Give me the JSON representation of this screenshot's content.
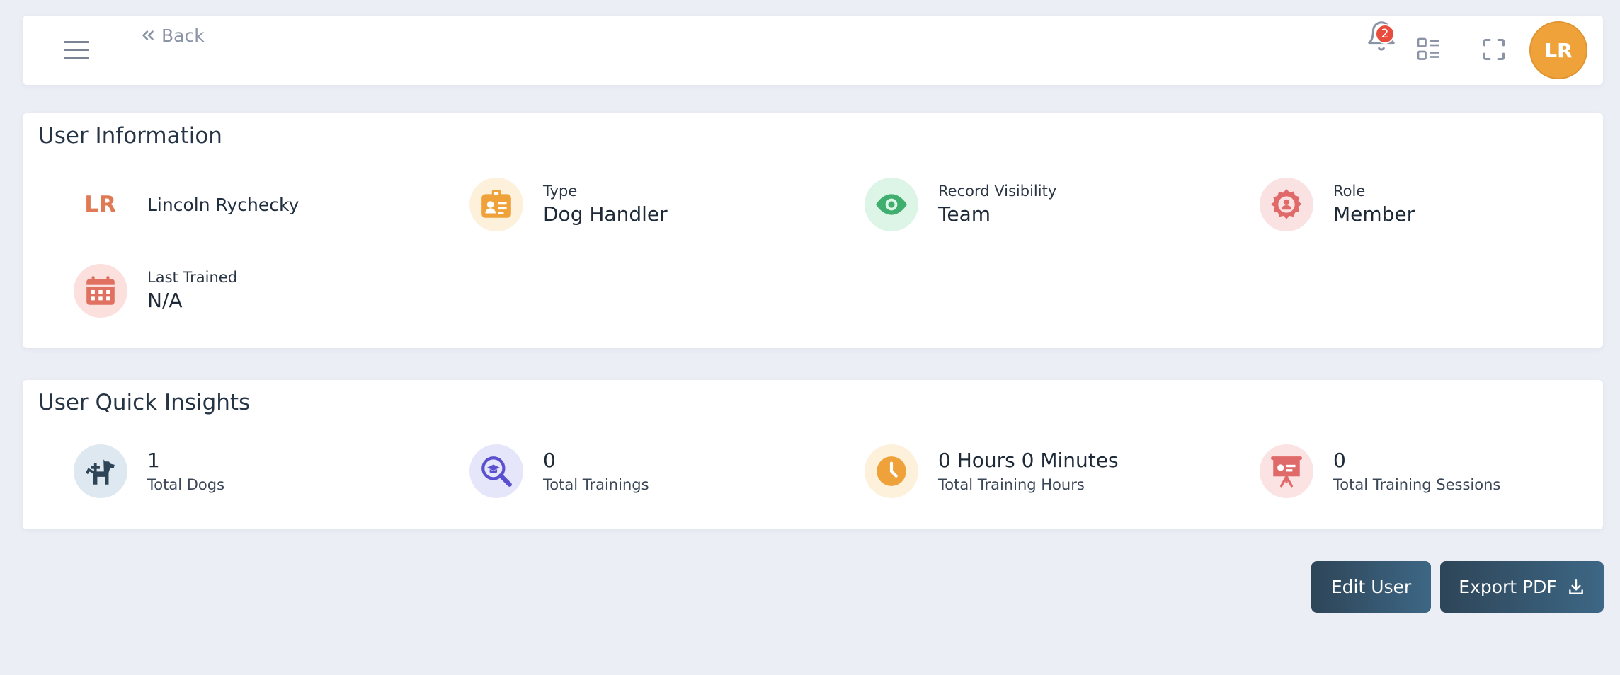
{
  "header": {
    "back_label": "Back",
    "notification_count": "2",
    "avatar_initials": "LR"
  },
  "user_info": {
    "title": "User Information",
    "initials": "LR",
    "name": "Lincoln Rychecky",
    "type_label": "Type",
    "type_value": "Dog Handler",
    "visibility_label": "Record Visibility",
    "visibility_value": "Team",
    "role_label": "Role",
    "role_value": "Member",
    "last_trained_label": "Last Trained",
    "last_trained_value": "N/A"
  },
  "insights": {
    "title": "User Quick Insights",
    "dogs_value": "1",
    "dogs_label": "Total Dogs",
    "trainings_value": "0",
    "trainings_label": "Total Trainings",
    "hours_value": "0 Hours 0 Minutes",
    "hours_label": "Total Training Hours",
    "sessions_value": "0",
    "sessions_label": "Total Training Sessions"
  },
  "actions": {
    "edit_label": "Edit User",
    "export_label": "Export PDF"
  },
  "icons": {
    "menu": "hamburger-menu-icon",
    "back": "chevrons-left-icon",
    "notifications": "bell-icon",
    "apps": "list-grid-icon",
    "fullscreen": "fullscreen-icon",
    "type": "id-badge-icon",
    "visibility": "eye-icon",
    "role": "user-gear-icon",
    "last_trained": "calendar-icon",
    "dogs": "dog-plus-icon",
    "trainings": "magnify-graduation-icon",
    "hours": "clock-icon",
    "sessions": "presentation-board-icon",
    "download": "download-icon"
  },
  "colors": {
    "accent_orange": "#f0a23a",
    "initials_orange": "#e07a55",
    "badge_red": "#e74c3c",
    "eye_green": "#3fae6e",
    "role_red": "#e06a6a",
    "calendar_red": "#e07060",
    "dog_navy": "#2e4558",
    "training_purple": "#5a4fcf",
    "button_start": "#2e4558",
    "button_end": "#3d6785"
  }
}
